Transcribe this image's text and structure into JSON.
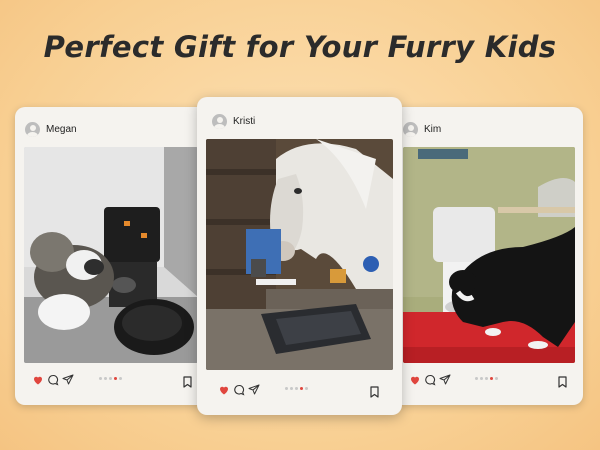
{
  "headline": "Perfect Gift for Your Furry Kids",
  "colors": {
    "like": "#e0463e",
    "icon": "#333333",
    "card": "#f5f3ef"
  },
  "icons": [
    "user-avatar-icon",
    "heart-icon",
    "comment-icon",
    "share-icon",
    "bookmark-icon"
  ],
  "posts": [
    {
      "user": "Megan",
      "carousel": {
        "count": 5,
        "active": 4
      }
    },
    {
      "user": "Kristi",
      "carousel": {
        "count": 5,
        "active": 4
      }
    },
    {
      "user": "Kim",
      "carousel": {
        "count": 5,
        "active": 4
      }
    }
  ]
}
